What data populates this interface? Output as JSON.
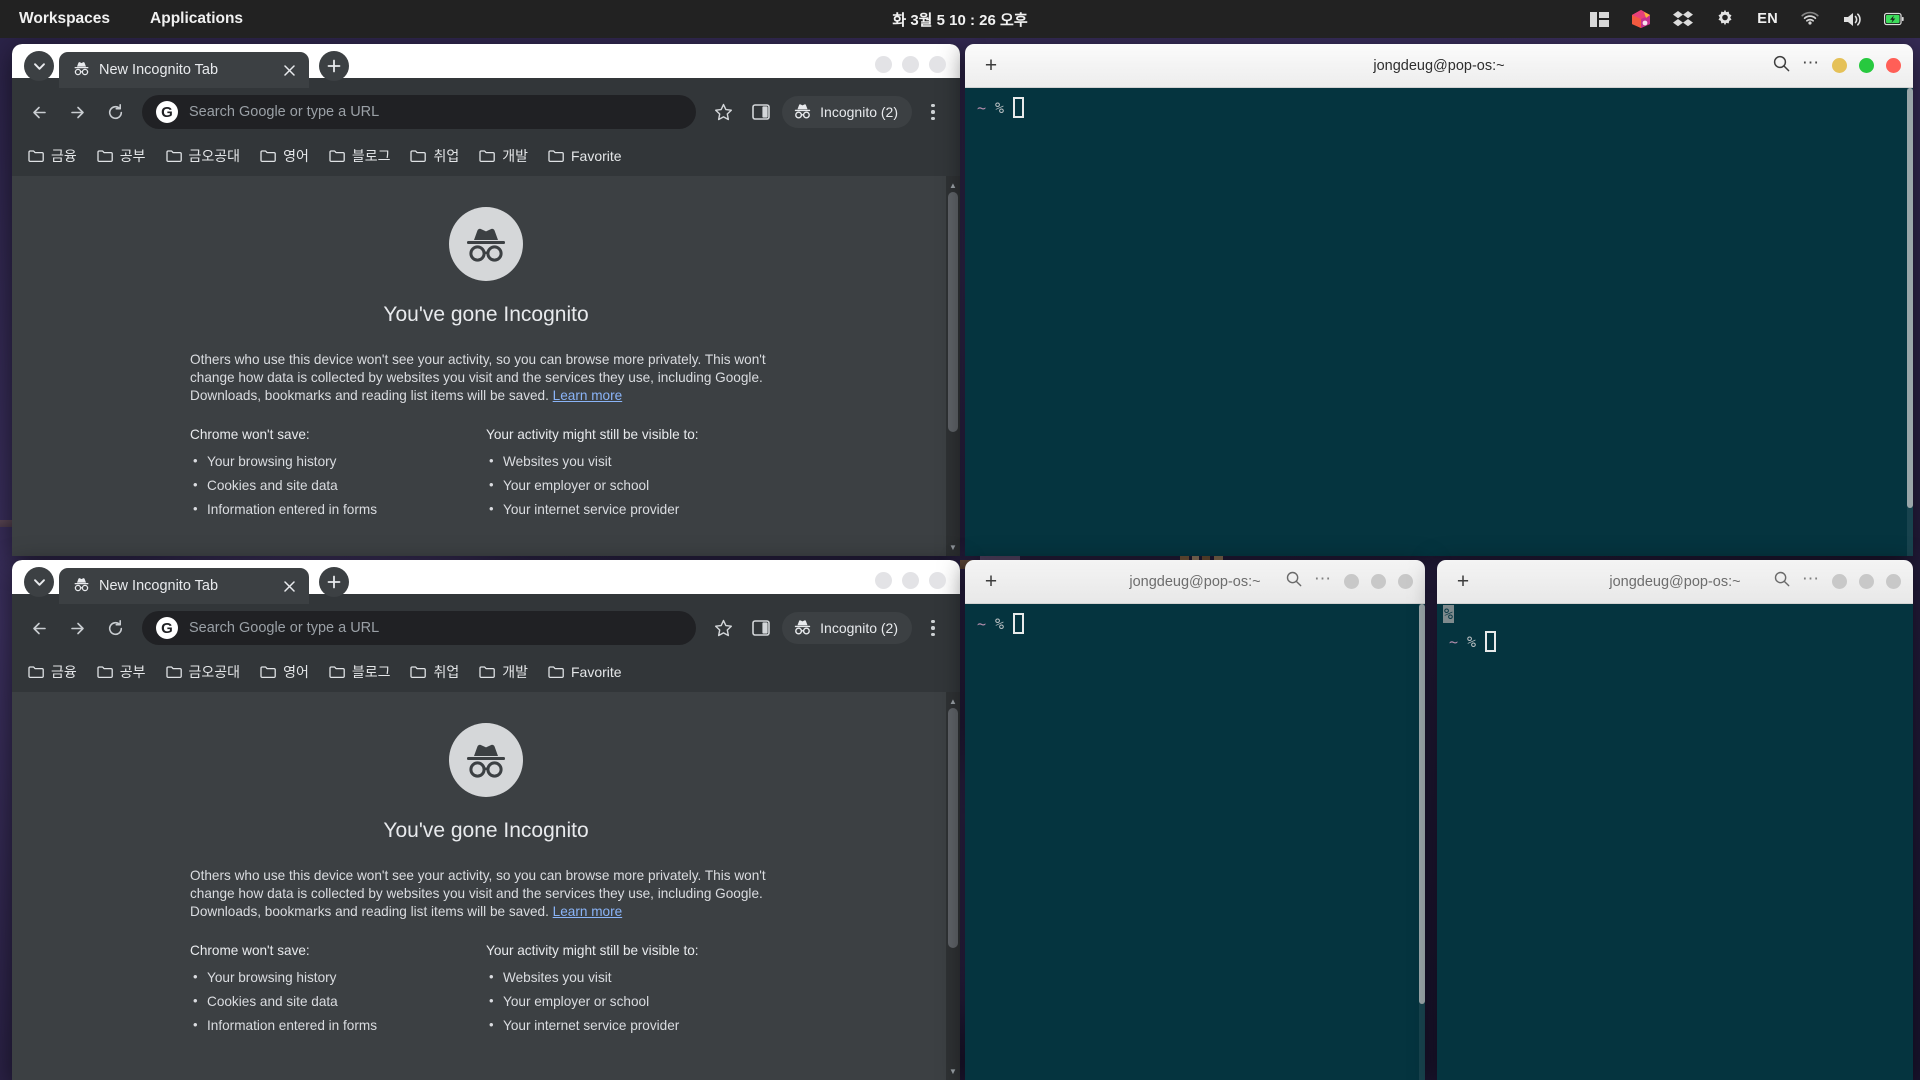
{
  "panel": {
    "workspaces_label": "Workspaces",
    "applications_label": "Applications",
    "clock": "화 3월 5  10 : 26 오후",
    "tray": {
      "layout_icon": "panel-layout-icon",
      "app_icon": "colorful-app-icon",
      "dropbox_icon": "dropbox-icon",
      "settings_icon": "gear-icon",
      "keyboard_layout": "EN",
      "wifi_icon": "wifi-icon",
      "volume_icon": "volume-icon",
      "battery_icon": "battery-charging-icon"
    }
  },
  "chrome": {
    "tab_title": "New Incognito Tab",
    "tab_favicon": "incognito-icon",
    "tab_close_label": "✕",
    "new_tab_label": "+",
    "tab_search_label": "⌄",
    "toolbar": {
      "back_label": "←",
      "forward_label": "→",
      "reload_label": "⟳",
      "bookmark_star": "☆",
      "side_panel": "side-panel-icon",
      "incognito_label": "Incognito (2)",
      "menu_label": "⋮"
    },
    "omnibox": {
      "placeholder": "Search Google or type a URL",
      "value": "",
      "google_letter": "G"
    },
    "bookmarks": [
      {
        "label": "금융"
      },
      {
        "label": "공부"
      },
      {
        "label": "금오공대"
      },
      {
        "label": "영어"
      },
      {
        "label": "블로그"
      },
      {
        "label": "취업"
      },
      {
        "label": "개발"
      },
      {
        "label": "Favorite"
      }
    ],
    "ntp": {
      "heading": "You've gone Incognito",
      "body_part1": "Others who use this device won't see your activity, so you can browse more privately. This won't change how data is collected by websites you visit and the services they use, including Google. Downloads, bookmarks and reading list items will be saved. ",
      "learn_more": "Learn more",
      "col_left_title": "Chrome won't save:",
      "col_left_items": [
        "Your browsing history",
        "Cookies and site data",
        "Information entered in forms"
      ],
      "col_right_title": "Your activity might still be visible to:",
      "col_right_items": [
        "Websites you visit",
        "Your employer or school",
        "Your internet service provider"
      ]
    }
  },
  "terminals": {
    "title": "jongdeug@pop-os:~",
    "new_tab_label": "+",
    "search_icon": "search-icon",
    "menu_label": "⋯",
    "prompt_tilde": "~",
    "prompt_symbol": "%",
    "ghost_char": "%"
  },
  "colors": {
    "panel_bg": "#222222",
    "chrome_toolbar": "#323639",
    "chrome_ntp": "#3c4043",
    "omnibox_bg": "#202124",
    "terminal_bg": "#05343f",
    "link_blue": "#8ab4f8",
    "close_red": "#ff5f57",
    "max_green": "#27c93f",
    "min_yellow": "#e5c158"
  }
}
